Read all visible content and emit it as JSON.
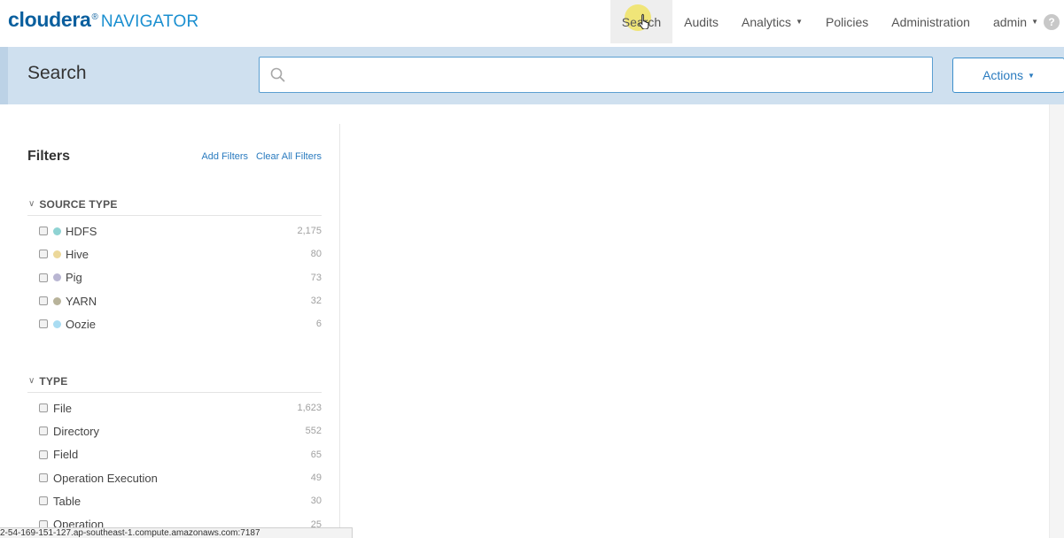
{
  "logo": {
    "brand": "cloudera",
    "mark": "®",
    "product": "NAVIGATOR"
  },
  "nav": {
    "items": [
      {
        "label": "Search",
        "active": true,
        "caret": false
      },
      {
        "label": "Audits",
        "active": false,
        "caret": false
      },
      {
        "label": "Analytics",
        "active": false,
        "caret": true
      },
      {
        "label": "Policies",
        "active": false,
        "caret": false
      },
      {
        "label": "Administration",
        "active": false,
        "caret": false
      },
      {
        "label": "admin",
        "active": false,
        "caret": true
      }
    ],
    "help_icon": "?"
  },
  "search": {
    "title": "Search",
    "placeholder": "",
    "value": "",
    "icon": "search-icon",
    "actions_label": "Actions"
  },
  "filters": {
    "title": "Filters",
    "add_label": "Add Filters",
    "clear_label": "Clear All Filters",
    "groups": [
      {
        "title": "SOURCE TYPE",
        "items": [
          {
            "label": "HDFS",
            "count": "2,175",
            "color": "#8fd3d3"
          },
          {
            "label": "Hive",
            "count": "80",
            "color": "#ecd89a"
          },
          {
            "label": "Pig",
            "count": "73",
            "color": "#b9b6d2"
          },
          {
            "label": "YARN",
            "count": "32",
            "color": "#b8b39a"
          },
          {
            "label": "Oozie",
            "count": "6",
            "color": "#a9dcf2"
          }
        ]
      },
      {
        "title": "TYPE",
        "items": [
          {
            "label": "File",
            "count": "1,623"
          },
          {
            "label": "Directory",
            "count": "552"
          },
          {
            "label": "Field",
            "count": "65"
          },
          {
            "label": "Operation Execution",
            "count": "49"
          },
          {
            "label": "Table",
            "count": "30"
          },
          {
            "label": "Operation",
            "count": "25"
          }
        ]
      }
    ]
  },
  "status_url": "2-54-169-151-127.ap-southeast-1.compute.amazonaws.com:7187",
  "colors": {
    "accent": "#2a7bbf",
    "band": "#cfe0ef",
    "brand": "#0a5f9e"
  }
}
